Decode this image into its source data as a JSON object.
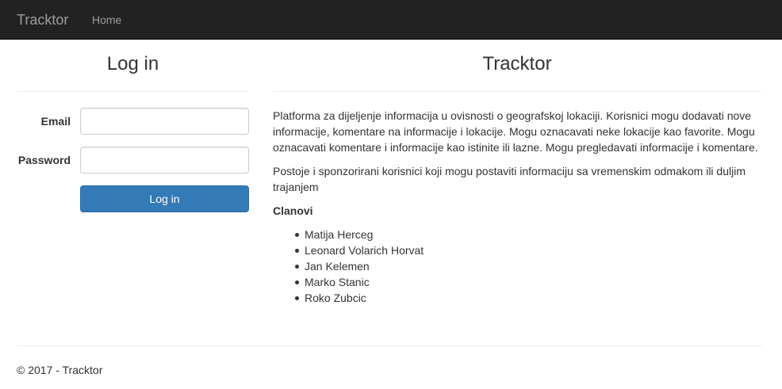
{
  "navbar": {
    "brand": "Tracktor",
    "links": [
      {
        "label": "Home"
      }
    ]
  },
  "login": {
    "title": "Log in",
    "email_label": "Email",
    "email_value": "",
    "password_label": "Password",
    "password_value": "",
    "submit_label": "Log in"
  },
  "info": {
    "title": "Tracktor",
    "paragraphs": [
      "Platforma za dijeljenje informacija u ovisnosti o geografskoj lokaciji. Korisnici mogu dodavati nove informacije, komentare na informacije i lokacije. Mogu oznacavati neke lokacije kao favorite. Mogu oznacavati komentare i informacije kao istinite ili lazne. Mogu pregledavati informacije i komentare.",
      "Postoje i sponzorirani korisnici koji mogu postaviti informaciju sa vremenskim odmakom ili duljim trajanjem"
    ],
    "members_title": "Clanovi",
    "members": [
      "Matija Herceg",
      "Leonard Volarich Horvat",
      "Jan Kelemen",
      "Marko Stanic",
      "Roko Zubcic"
    ]
  },
  "footer": {
    "text": "© 2017 - Tracktor"
  },
  "colors": {
    "navbar_bg": "#222222",
    "navbar_text": "#9d9d9d",
    "primary_button": "#337ab7"
  }
}
